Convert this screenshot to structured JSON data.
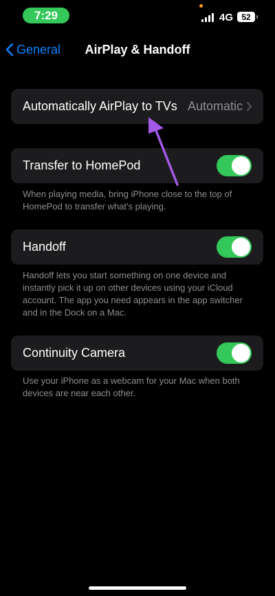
{
  "status_bar": {
    "time": "7:29",
    "network": "4G",
    "battery": "52"
  },
  "nav": {
    "back_label": "General",
    "title": "AirPlay & Handoff"
  },
  "rows": {
    "airplay": {
      "label": "Automatically AirPlay to TVs",
      "value": "Automatic"
    },
    "homepod": {
      "label": "Transfer to HomePod",
      "on": true,
      "footer": "When playing media, bring iPhone close to the top of HomePod to transfer what's playing."
    },
    "handoff": {
      "label": "Handoff",
      "on": true,
      "footer": "Handoff lets you start something on one device and instantly pick it up on other devices using your iCloud account. The app you need appears in the app switcher and in the Dock on a Mac."
    },
    "continuity": {
      "label": "Continuity Camera",
      "on": true,
      "footer": "Use your iPhone as a webcam for your Mac when both devices are near each other."
    }
  },
  "colors": {
    "accent": "#0a84ff",
    "toggle_on": "#34c759",
    "annotation_arrow": "#a259e6"
  }
}
